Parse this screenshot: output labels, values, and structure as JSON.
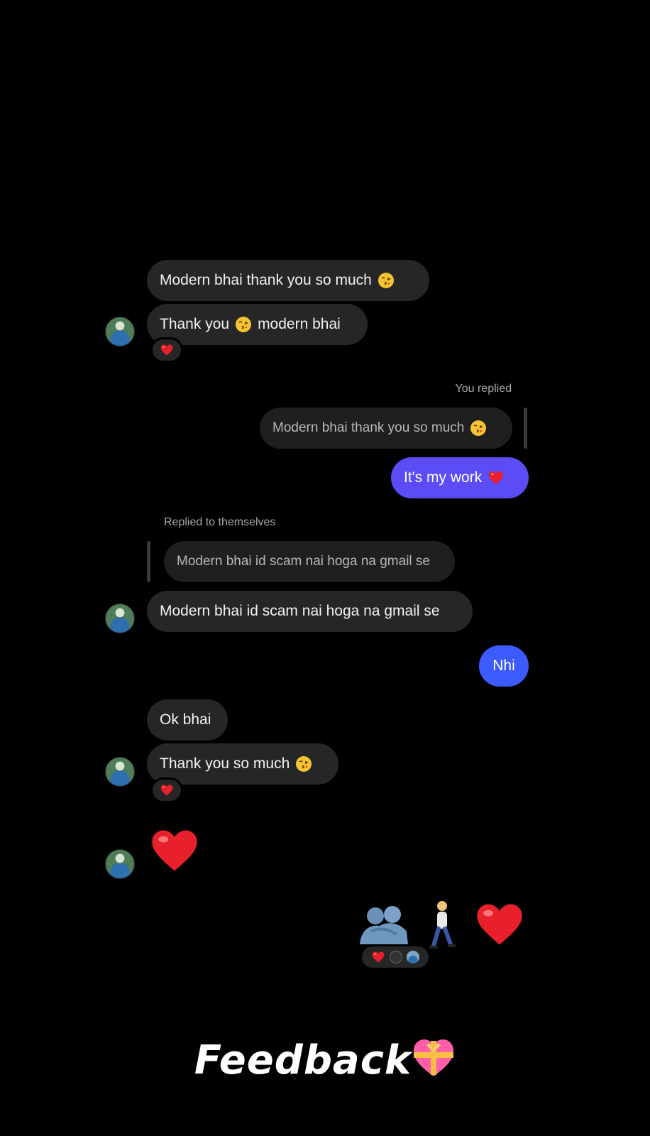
{
  "messages": {
    "m1": "Modern bhai thank you so much",
    "m2_pre": "Thank you",
    "m2_post": "modern bhai",
    "you_replied": "You replied",
    "reply_quote": "Modern bhai thank you so much",
    "reply": "It's my work",
    "replied_themselves": "Replied to themselves",
    "self_quote": "Modern bhai id scam nai hoga na gmail se",
    "m3": "Modern bhai id scam nai hoga na gmail se",
    "m4": "Nhi",
    "m5": "Ok bhai",
    "m6": "Thank you so much"
  },
  "footer": {
    "caption": "Feedback"
  },
  "colors": {
    "sent_purple": "#5b4cf5",
    "sent_blue": "#3b5bff",
    "received": "#262626"
  },
  "icons": [
    "kissing-face-emoji",
    "red-heart-emoji",
    "hug-people-emoji",
    "walking-person-emoji",
    "heart-ribbon-emoji",
    "avatar"
  ]
}
